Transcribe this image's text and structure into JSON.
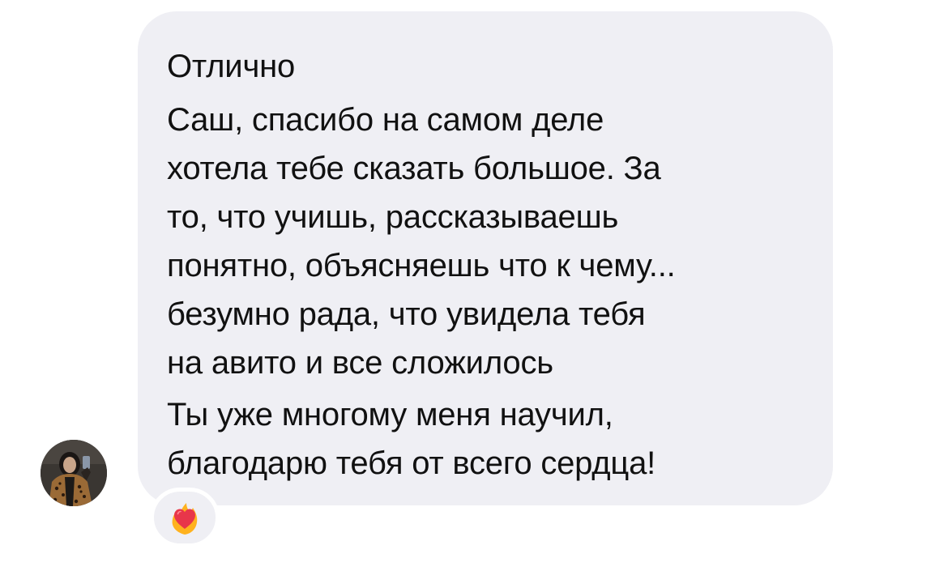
{
  "message": {
    "paragraphs": [
      {
        "lines": [
          "Отлично"
        ]
      },
      {
        "lines": [
          "Саш, спасибо на самом деле",
          "хотела тебе сказать большое. За",
          "то, что учишь, рассказываешь",
          "понятно, объясняешь что к чему...",
          "безумно рада, что увидела тебя",
          "на авито и все сложилось"
        ]
      },
      {
        "lines": [
          "Ты уже многому меня научил,",
          "благодарю тебя от всего сердца!"
        ]
      }
    ]
  },
  "reaction": {
    "icon": "heart-on-fire-icon",
    "colors": {
      "heart": "#e8364a",
      "flame": "#ffb21e"
    }
  },
  "avatar": {
    "icon": "user-avatar-photo"
  },
  "colors": {
    "bubble": "#efeff4",
    "text": "#111111",
    "background": "#ffffff"
  }
}
